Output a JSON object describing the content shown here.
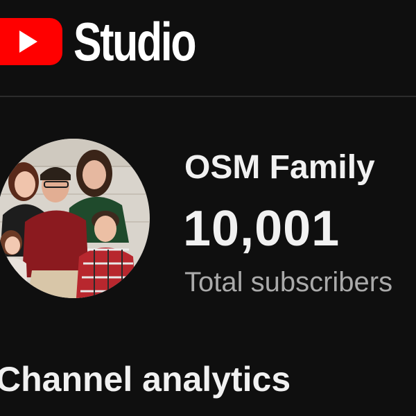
{
  "header": {
    "logo_icon": "youtube-play-logo-icon",
    "app_title": "Studio"
  },
  "channel": {
    "name": "OSM Family",
    "subscriber_count": "10,001",
    "subscriber_label": "Total subscribers"
  },
  "section": {
    "title": "Channel analytics"
  },
  "colors": {
    "background": "#0f0f0f",
    "brand_red": "#ff0000",
    "text_primary": "#f1f1f1",
    "text_secondary": "#aaaaaa",
    "divider": "#2c2c2c"
  }
}
